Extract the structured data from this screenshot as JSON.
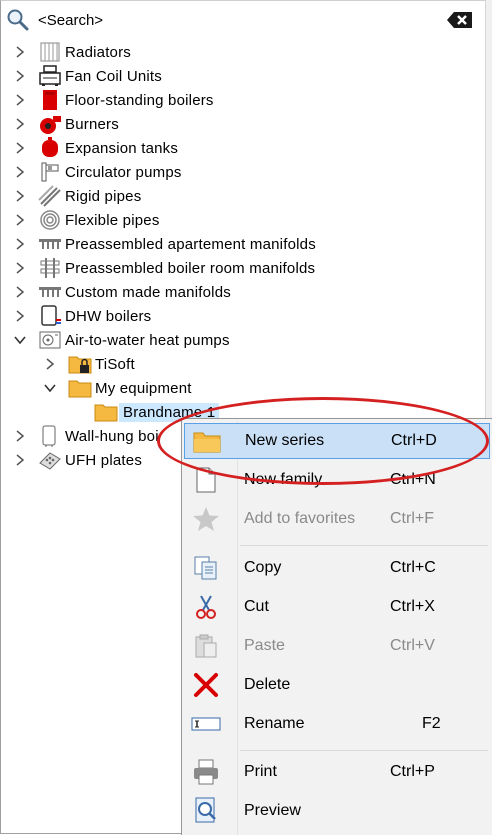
{
  "search": {
    "placeholder": "<Search>"
  },
  "tree": {
    "items": [
      {
        "label": "Radiators",
        "icon": "radiator-icon"
      },
      {
        "label": "Fan Coil Units",
        "icon": "fan-coil-icon"
      },
      {
        "label": "Floor-standing boilers",
        "icon": "boiler-icon"
      },
      {
        "label": "Burners",
        "icon": "burner-icon"
      },
      {
        "label": "Expansion tanks",
        "icon": "expansion-tank-icon"
      },
      {
        "label": "Circulator pumps",
        "icon": "pump-icon"
      },
      {
        "label": "Rigid pipes",
        "icon": "rigid-pipe-icon"
      },
      {
        "label": "Flexible pipes",
        "icon": "flexible-pipe-icon"
      },
      {
        "label": "Preassembled apartement manifolds",
        "icon": "manifold-icon"
      },
      {
        "label": "Preassembled boiler room manifolds",
        "icon": "boiler-room-manifold-icon"
      },
      {
        "label": "Custom made manifolds",
        "icon": "custom-manifold-icon"
      },
      {
        "label": "DHW boilers",
        "icon": "dhw-boiler-icon"
      },
      {
        "label": "Air-to-water heat pumps",
        "icon": "heat-pump-icon"
      },
      {
        "label": "TiSoft",
        "icon": "locked-folder-icon"
      },
      {
        "label": "My equipment",
        "icon": "folder-icon"
      },
      {
        "label": "Brandname 1",
        "icon": "folder-icon"
      },
      {
        "label": "Wall-hung boi",
        "icon": "wall-hung-boiler-icon"
      },
      {
        "label": "UFH plates",
        "icon": "ufh-plate-icon"
      }
    ]
  },
  "context_menu": {
    "items": [
      {
        "label": "New series",
        "shortcut": "Ctrl+D",
        "icon": "folder-icon",
        "state": "highlighted"
      },
      {
        "label": "New family",
        "shortcut": "Ctrl+N",
        "icon": "document-icon",
        "state": "enabled"
      },
      {
        "label": "Add to favorites",
        "shortcut": "Ctrl+F",
        "icon": "star-icon",
        "state": "disabled"
      },
      {
        "label": "Copy",
        "shortcut": "Ctrl+C",
        "icon": "copy-icon",
        "state": "enabled"
      },
      {
        "label": "Cut",
        "shortcut": "Ctrl+X",
        "icon": "scissors-icon",
        "state": "enabled"
      },
      {
        "label": "Paste",
        "shortcut": "Ctrl+V",
        "icon": "paste-icon",
        "state": "disabled"
      },
      {
        "label": "Delete",
        "shortcut": "",
        "icon": "delete-x-icon",
        "state": "enabled"
      },
      {
        "label": "Rename",
        "shortcut": "F2",
        "icon": "rename-icon",
        "state": "enabled"
      },
      {
        "label": "Print",
        "shortcut": "Ctrl+P",
        "icon": "printer-icon",
        "state": "enabled"
      },
      {
        "label": "Preview",
        "shortcut": "",
        "icon": "preview-icon",
        "state": "enabled"
      }
    ]
  },
  "colors": {
    "highlight": "#c9e0f7",
    "annotation": "#d42020",
    "folder": "#f5b942",
    "red_device": "#d80000"
  }
}
